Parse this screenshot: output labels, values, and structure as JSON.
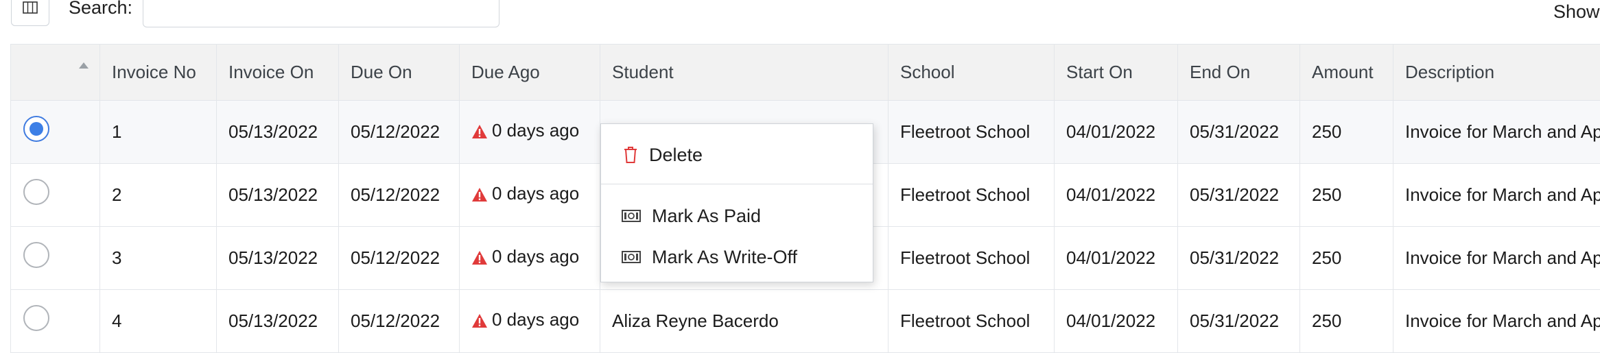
{
  "toolbar": {
    "columns_icon": "columns-icon",
    "search_label": "Search:",
    "search_value": "",
    "search_placeholder": "",
    "show_label": "Show"
  },
  "table": {
    "columns": [
      "Invoice No",
      "Invoice On",
      "Due On",
      "Due Ago",
      "Student",
      "School",
      "Start On",
      "End On",
      "Amount",
      "Description"
    ],
    "sort_icon": "sort-up-icon",
    "warning_icon": "warning-triangle-icon",
    "rows": [
      {
        "selected": true,
        "invoice_no": "1",
        "invoice_on": "05/13/2022",
        "due_on": "05/12/2022",
        "due_ago": "0 days ago",
        "student": "",
        "school": "Fleetroot School",
        "start_on": "04/01/2022",
        "end_on": "05/31/2022",
        "amount": "250",
        "description": "Invoice for March and Ap"
      },
      {
        "selected": false,
        "invoice_no": "2",
        "invoice_on": "05/13/2022",
        "due_on": "05/12/2022",
        "due_ago": "0 days ago",
        "student": "",
        "school": "Fleetroot School",
        "start_on": "04/01/2022",
        "end_on": "05/31/2022",
        "amount": "250",
        "description": "Invoice for March and Ap"
      },
      {
        "selected": false,
        "invoice_no": "3",
        "invoice_on": "05/13/2022",
        "due_on": "05/12/2022",
        "due_ago": "0 days ago",
        "student": "",
        "school": "Fleetroot School",
        "start_on": "04/01/2022",
        "end_on": "05/31/2022",
        "amount": "250",
        "description": "Invoice for March and Ap"
      },
      {
        "selected": false,
        "invoice_no": "4",
        "invoice_on": "05/13/2022",
        "due_on": "05/12/2022",
        "due_ago": "0 days ago",
        "student": "Aliza Reyne Bacerdo",
        "school": "Fleetroot School",
        "start_on": "04/01/2022",
        "end_on": "05/31/2022",
        "amount": "250",
        "description": "Invoice for March and Ap"
      }
    ]
  },
  "context_menu": {
    "delete_label": "Delete",
    "delete_icon": "trash-icon",
    "mark_paid_label": "Mark As Paid",
    "mark_writeoff_label": "Mark As Write-Off",
    "money_icon": "banknote-icon"
  },
  "colors": {
    "accent": "#3d7fe6",
    "warning": "#e03a3a",
    "header_bg": "#f2f2f2"
  }
}
